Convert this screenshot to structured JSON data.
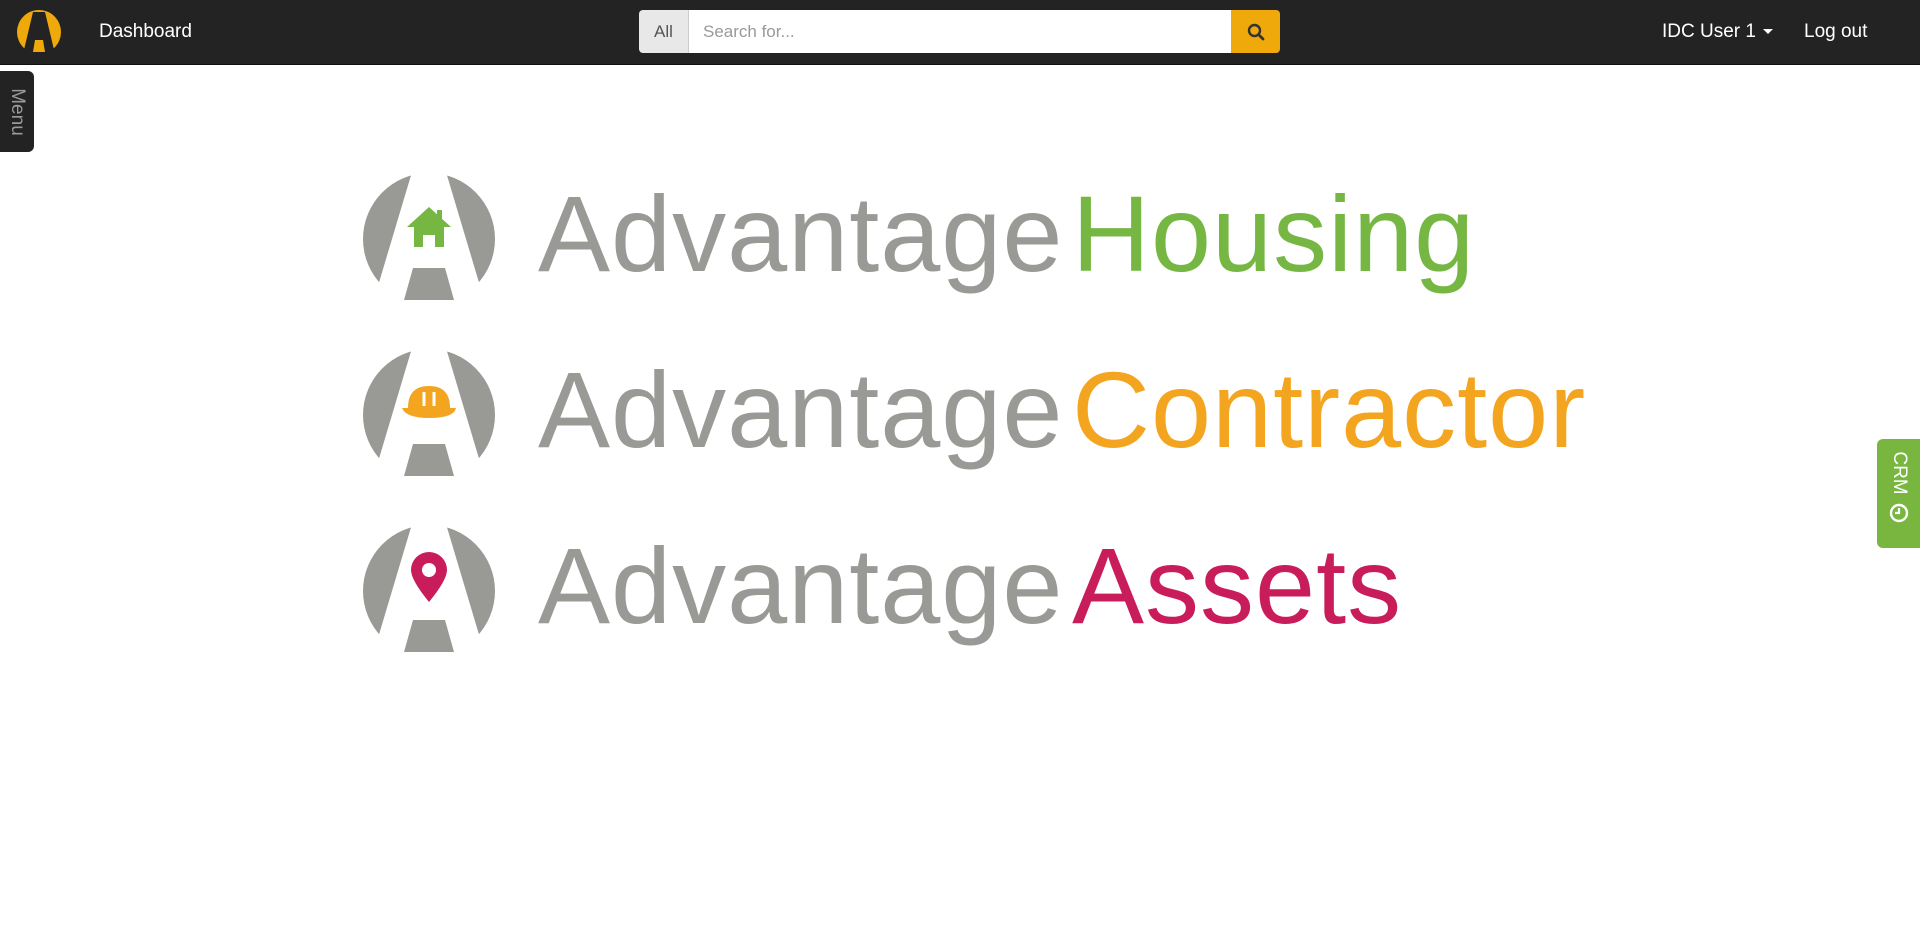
{
  "navbar": {
    "dashboard_label": "Dashboard",
    "search": {
      "scope_label": "All",
      "placeholder": "Search for...",
      "value": ""
    },
    "user_label": "IDC User 1",
    "logout_label": "Log out",
    "icons": [
      "brand-logo",
      "search-icon",
      "caret-down-icon"
    ]
  },
  "side_tabs": {
    "menu_label": "Menu",
    "crm_label": "CRM"
  },
  "products": [
    {
      "prefix": "Advantage",
      "name": "Housing",
      "icon": "house-icon",
      "color": "#76b744"
    },
    {
      "prefix": "Advantage",
      "name": "Contractor",
      "icon": "hard-hat-icon",
      "color": "#f4a520"
    },
    {
      "prefix": "Advantage",
      "name": "Assets",
      "icon": "map-pin-icon",
      "color": "#c91c5a"
    }
  ],
  "colors": {
    "navbar_bg": "#222322",
    "accent": "#f0a90a",
    "logo_grey": "#999a96",
    "crm_green": "#78b640"
  }
}
